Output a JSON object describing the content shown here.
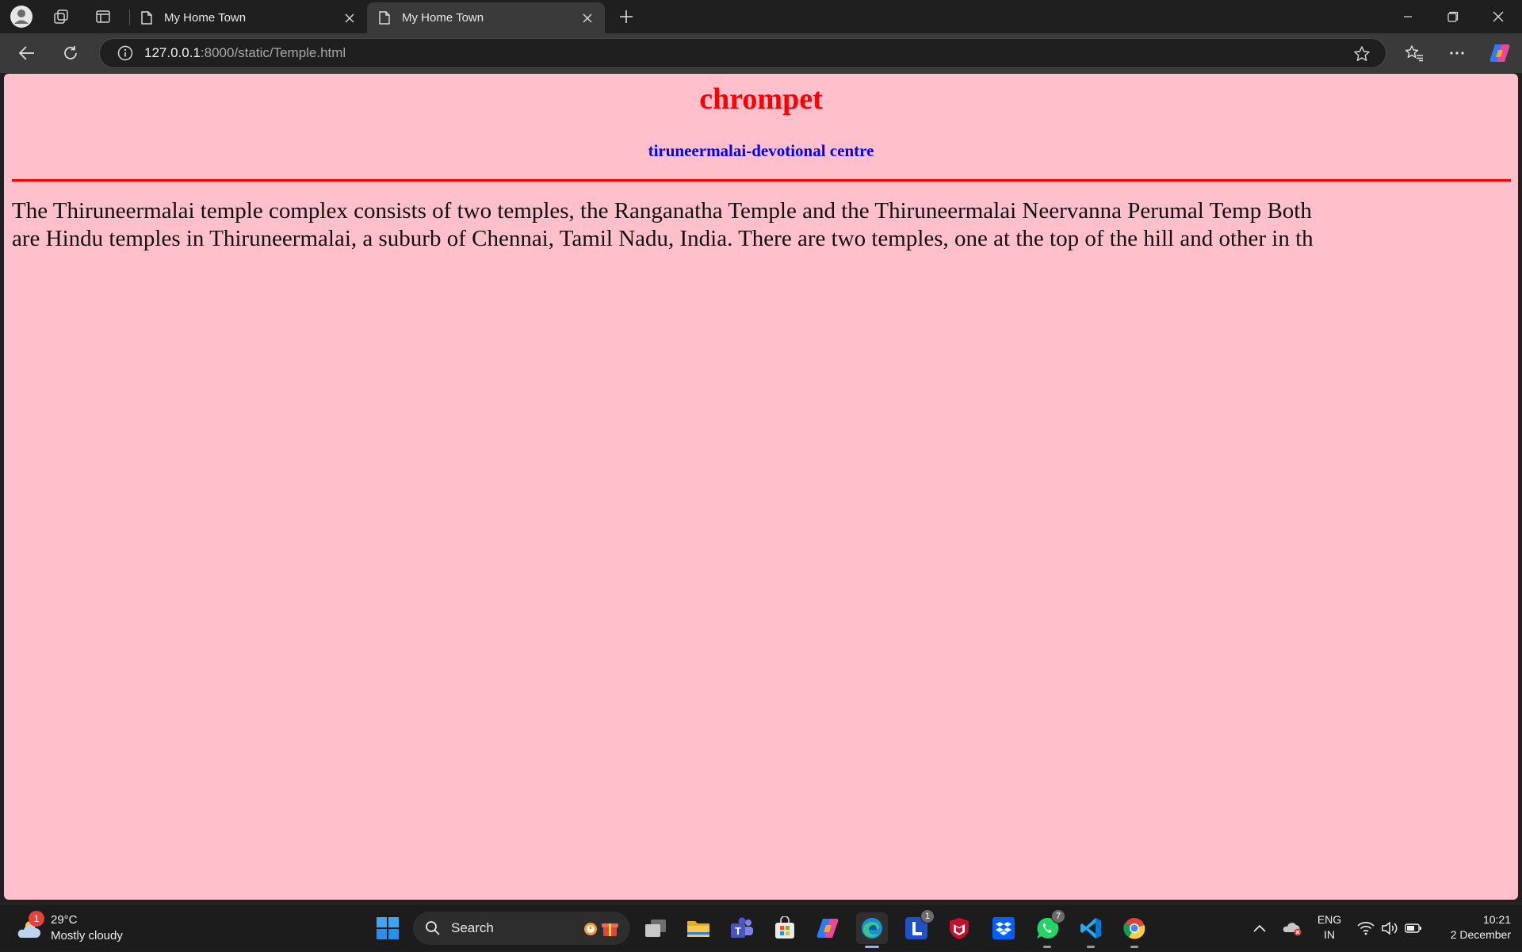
{
  "browser": {
    "tabs": [
      {
        "title": "My Home Town",
        "active": false
      },
      {
        "title": "My Home Town",
        "active": true
      }
    ],
    "address": {
      "host": "127.0.0.1",
      "rest": ":8000/static/Temple.html"
    }
  },
  "page": {
    "heading": "chrompet",
    "subheading": "tiruneermalai-devotional centre",
    "paragraph_line1": "The Thiruneermalai temple complex consists of two temples, the Ranganatha Temple and the Thiruneermalai Neervanna Perumal Temp Both",
    "paragraph_line2": "are Hindu temples in Thiruneermalai, a suburb of Chennai, Tamil Nadu, India. There are two temples, one at the top of the hill and other in th",
    "colors": {
      "background": "#ffc0cb",
      "heading": "#ff0000",
      "subheading": "#0000ff",
      "rule": "#ff0000"
    }
  },
  "taskbar": {
    "weather": {
      "temp": "29°C",
      "condition": "Mostly cloudy",
      "badge": "1"
    },
    "search_label": "Search",
    "pinned": [
      {
        "name": "start",
        "icon": "windows-logo-icon"
      },
      {
        "name": "task-view",
        "icon": "task-view-icon"
      },
      {
        "name": "file-explorer",
        "icon": "folder-icon"
      },
      {
        "name": "teams",
        "icon": "teams-icon"
      },
      {
        "name": "store",
        "icon": "store-icon"
      },
      {
        "name": "copilot",
        "icon": "copilot-icon"
      },
      {
        "name": "edge",
        "icon": "edge-icon"
      },
      {
        "name": "app-l",
        "icon": "l-app-icon",
        "badge": "1"
      },
      {
        "name": "mcafee",
        "icon": "mcafee-icon"
      },
      {
        "name": "dropbox",
        "icon": "dropbox-icon"
      },
      {
        "name": "whatsapp",
        "icon": "whatsapp-icon",
        "badge": "7"
      },
      {
        "name": "vscode",
        "icon": "vscode-icon"
      },
      {
        "name": "chrome",
        "icon": "chrome-icon"
      }
    ],
    "language": {
      "line1": "ENG",
      "line2": "IN"
    },
    "clock": {
      "time": "10:21",
      "date": "2 December"
    }
  }
}
